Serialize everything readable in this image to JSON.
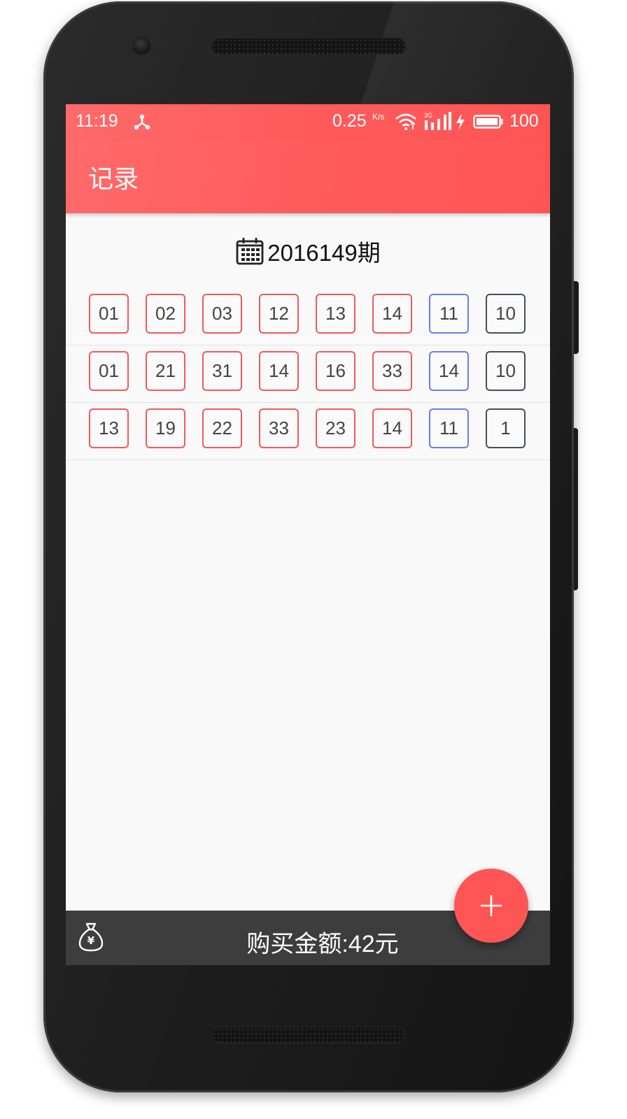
{
  "status_bar": {
    "time": "11:19",
    "network_speed": "0.25",
    "network_speed_unit": "K/s",
    "signal_label": "3G",
    "battery": "100"
  },
  "app_bar": {
    "title": "记录"
  },
  "issue": {
    "label": "2016149期"
  },
  "tickets": [
    {
      "red": [
        "01",
        "02",
        "03",
        "12",
        "13",
        "14"
      ],
      "blue": "11",
      "multiple": "10"
    },
    {
      "red": [
        "01",
        "21",
        "31",
        "14",
        "16",
        "33"
      ],
      "blue": "14",
      "multiple": "10"
    },
    {
      "red": [
        "13",
        "19",
        "22",
        "33",
        "23",
        "14"
      ],
      "blue": "11",
      "multiple": "1"
    }
  ],
  "bottom_bar": {
    "total": "购买金额:42元"
  },
  "fab": {
    "icon": "plus-icon"
  },
  "colors": {
    "accent": "#ff5c5c",
    "red_ball_border": "#f05a5a",
    "blue_ball_border": "#6b7ce6",
    "multiple_border": "#4a4e56",
    "bottom_bar": "#3d3d3d"
  }
}
